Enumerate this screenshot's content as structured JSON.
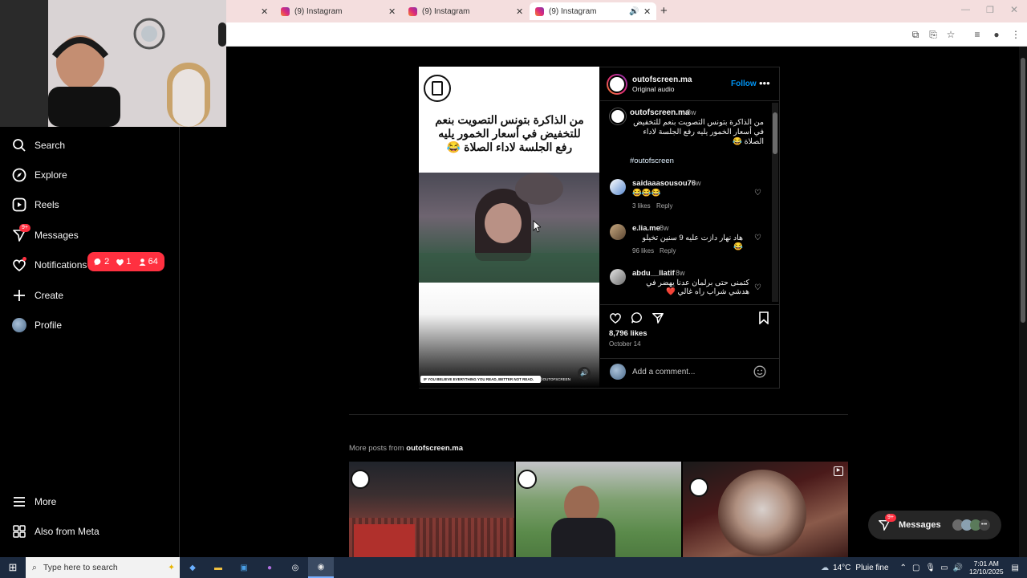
{
  "browser": {
    "tabs": [
      {
        "title": "(9) Instagram"
      },
      {
        "title": "(9) Instagram"
      },
      {
        "title": "(9) Instagram"
      }
    ]
  },
  "sidebar": {
    "items": [
      {
        "label": "Search",
        "icon": "search-icon"
      },
      {
        "label": "Explore",
        "icon": "compass-icon"
      },
      {
        "label": "Reels",
        "icon": "reels-icon"
      },
      {
        "label": "Messages",
        "icon": "messenger-icon",
        "badge": "9+"
      },
      {
        "label": "Notifications",
        "icon": "heart-icon"
      },
      {
        "label": "Create",
        "icon": "plus-icon"
      },
      {
        "label": "Profile",
        "icon": "avatar-icon"
      }
    ],
    "bottom": [
      {
        "label": "More",
        "icon": "menu-icon"
      },
      {
        "label": "Also from Meta",
        "icon": "meta-icon"
      }
    ],
    "notification_popup": {
      "comments": "2",
      "likes": "1",
      "follows": "64"
    }
  },
  "post": {
    "caption_overlay": "من الذاكرة بتونس  التصويت بنعم للتخفيض في أسعار الخمور يليه رفع الجلسة لاداء الصلاة 😂",
    "footer_banner": "IF YOU BELIEVE EVERYTHING YOU READ, BETTER NOT READ.",
    "footer_handle": "@OUTOFSCREEN",
    "header": {
      "username": "outofscreen.ma",
      "subtitle": "Original audio",
      "follow_label": "Follow"
    },
    "caption": {
      "username": "outofscreen.ma",
      "time": "8w",
      "text": "من الذاكرة بتونس  التصويت بنعم للتخفيض في أسعار الخمور يليه رفع الجلسة لاداء الصلاة 😂",
      "hashtag": "#outofscreen"
    },
    "comments": [
      {
        "username": "saidaaasousou76",
        "time": "8w",
        "text": "😂😂😂",
        "likes": "3 likes",
        "reply": "Reply"
      },
      {
        "username": "e.lia.me",
        "time": "8w",
        "text": "هاد نهار دازت عليه 9 سنين تخيلو 😂",
        "likes": "96 likes",
        "reply": "Reply"
      },
      {
        "username": "abdu__llatif",
        "time": "8w",
        "text": "كتمنى حتى برلمان عدنا يهضر في هدشي شراب راه غالي ❤️",
        "likes": "",
        "reply": ""
      }
    ],
    "likes_count": "8,796 likes",
    "date": "October 14",
    "add_comment_placeholder": "Add a comment..."
  },
  "more_posts": {
    "prefix": "More posts from ",
    "username": "outofscreen.ma"
  },
  "messages_float": {
    "label": "Messages",
    "badge": "9+"
  },
  "taskbar": {
    "search_placeholder": "Type here to search",
    "weather_temp": "14°C",
    "weather_desc": "Pluie fine",
    "time": "7:01 AM",
    "date": "12/10/2025"
  },
  "colors": {
    "accent_blue": "#0095f6",
    "notification_red": "#ff3040",
    "hashtag": "#e0f1ff"
  }
}
